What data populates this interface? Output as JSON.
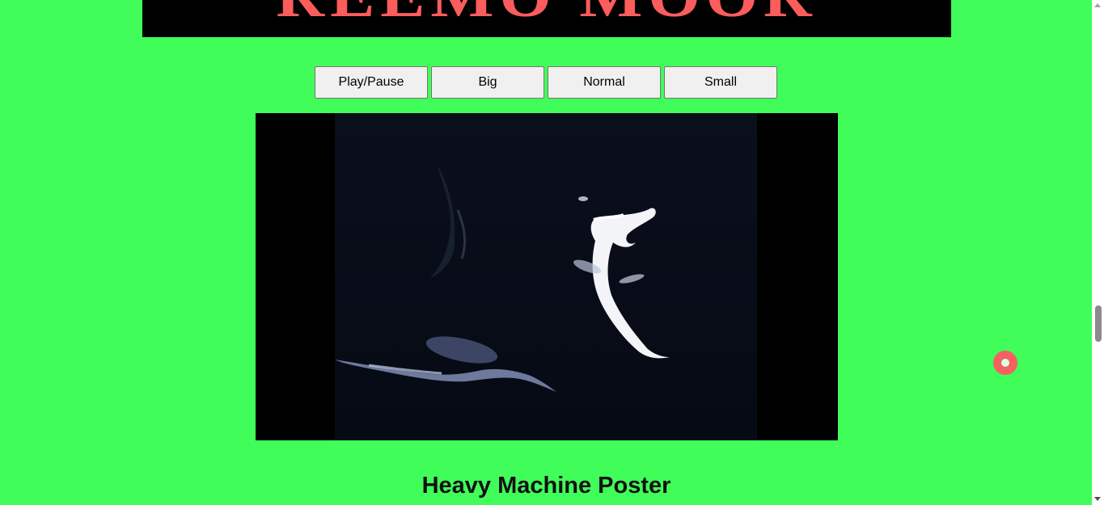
{
  "banner": {
    "title": "REEMO MOOR"
  },
  "controls": {
    "play_pause_label": "Play/Pause",
    "big_label": "Big",
    "normal_label": "Normal",
    "small_label": "Small"
  },
  "video": {
    "content": "underwater-creatures"
  },
  "section": {
    "title": "Heavy Machine Poster"
  },
  "colors": {
    "page_background": "#41fd59",
    "banner_background": "#000000",
    "banner_text": "#fb5c5c",
    "cursor_ring": "#f56060"
  }
}
